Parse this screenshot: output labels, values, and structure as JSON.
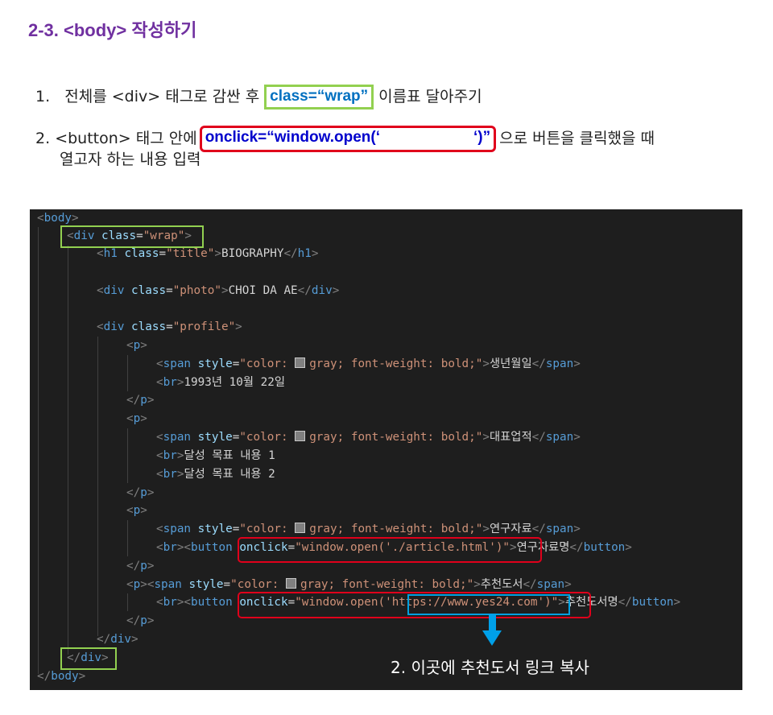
{
  "section_title": "2-3. <body> 작성하기",
  "steps": {
    "step1": {
      "number": "1.",
      "before": "전체를 <div> 태그로 감싼 후",
      "boxed": "class=“wrap”",
      "after": "이름표 달아주기"
    },
    "step2": {
      "number": "2.",
      "before": "<button> 태그 안에",
      "boxed_open": "onclick=“window.open(‘",
      "boxed_close": "‘)”",
      "after": "으로 버튼을 클릭했을 때",
      "line2": "열고자 하는 내용 입력"
    }
  },
  "code": {
    "swatch_color": "#808080",
    "tokens": {
      "t_body": "body",
      "t_div": "div",
      "t_class": "class",
      "v_wrap": "\"wrap\"",
      "t_h1": "h1",
      "v_title": "\"title\"",
      "h1_text": "BIOGRAPHY",
      "v_photo": "\"photo\"",
      "photo_text": "CHOI DA AE",
      "v_profile": "\"profile\"",
      "t_p": "p",
      "t_span": "span",
      "t_style": "style",
      "v_style_open": "\"color: ",
      "v_style_close": "gray; font-weight: bold;\"",
      "t_br": "br",
      "t_button": "button",
      "t_onclick": "onclick",
      "v_onclick_open": "\"window.open('",
      "v_onclick_close": "')\"",
      "v_article": "./article.html",
      "v_yes24": "https://www.yes24.com",
      "label_birth": "생년월일",
      "birth_value": "1993년 10월 22일",
      "label_work": "대표업적",
      "goal1": "달성 목표 내용 1",
      "goal2": "달성 목표 내용 2",
      "label_research": "연구자료",
      "button_research": "연구자료명",
      "label_books": "추천도서",
      "button_books": "추천도서명"
    }
  },
  "annotation": "2. 이곳에 추천도서 링크 복사"
}
